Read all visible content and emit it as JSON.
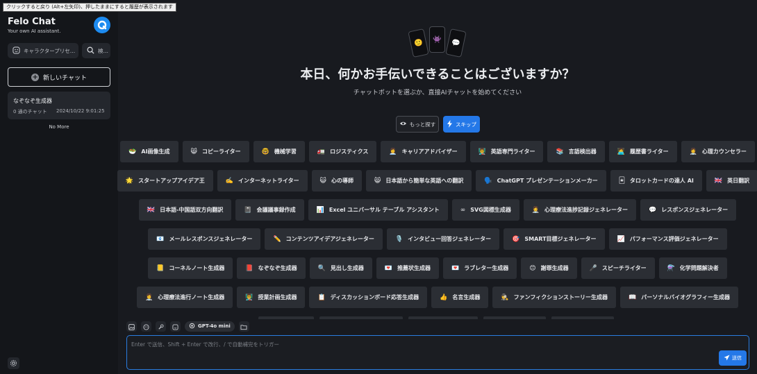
{
  "tooltip": "クリックすると戻り (Alt+左矢印)、押したままにすると履歴が表示されます",
  "sidebar": {
    "title": "Felo Chat",
    "subtitle": "Your own AI assistant.",
    "character_chip": "キャラクタープリセ…",
    "search_chip": "検…",
    "new_chat": "新しいチャット",
    "history": [
      {
        "title": "なぞなぞ生成器",
        "count": "0 通のチャット",
        "date": "2024/10/22 9:01:25"
      }
    ],
    "no_more": "No More"
  },
  "main": {
    "heading": "本日、何かお手伝いできることはございますか？",
    "subheading": "チャットボットを選ぶか、直接AIチャットを始めてください",
    "explore_label": "もっと探す",
    "skip_label": "スキップ",
    "rows": [
      [
        {
          "emoji": "🥗",
          "label": "AI画像生成"
        },
        {
          "emoji": "😸",
          "label": "コピーライター"
        },
        {
          "emoji": "🤓",
          "label": "機械学習"
        },
        {
          "emoji": "🚛",
          "label": "ロジスティクス"
        },
        {
          "emoji": "👩‍💼",
          "label": "キャリアアドバイザー"
        },
        {
          "emoji": "👨‍🏫",
          "label": "英語専門ライター"
        },
        {
          "emoji": "📚",
          "label": "言語検出器"
        },
        {
          "emoji": "🧑‍💻",
          "label": "履歴書ライター"
        },
        {
          "emoji": "👩‍⚕️",
          "label": "心理カウンセラー"
        }
      ],
      [
        {
          "emoji": "🌟",
          "label": "スタートアップアイデア王"
        },
        {
          "emoji": "✍️",
          "label": "インターネットライター"
        },
        {
          "emoji": "😺",
          "label": "心の導師"
        },
        {
          "emoji": "😸",
          "label": "日本語から簡単な英語への翻訳"
        },
        {
          "emoji": "🗣️",
          "label": "ChatGPT プレゼンテーションメーカー"
        },
        {
          "emoji": "🃏",
          "label": "タロットカードの達人 AI"
        },
        {
          "emoji": "🇬🇧",
          "label": "英日翻訳"
        }
      ],
      [
        {
          "emoji": "🇬🇧",
          "label": "日本語-中国語双方向翻訳"
        },
        {
          "emoji": "📓",
          "label": "会議議事録作成"
        },
        {
          "emoji": "📊",
          "label": "Excel ユニバーサル テーブル アシスタント"
        },
        {
          "emoji": "∞",
          "label": "SVG図標生成器"
        },
        {
          "emoji": "👩‍⚕️",
          "label": "心理療法進捗記録ジェネレーター"
        },
        {
          "emoji": "💬",
          "label": "レスポンスジェネレーター"
        }
      ],
      [
        {
          "emoji": "📧",
          "label": "メールレスポンスジェネレーター"
        },
        {
          "emoji": "✏️",
          "label": "コンテンツアイデアジェネレーター"
        },
        {
          "emoji": "🎙️",
          "label": "インタビュー回答ジェネレーター"
        },
        {
          "emoji": "🎯",
          "label": "SMART目標ジェネレーター"
        },
        {
          "emoji": "📈",
          "label": "パフォーマンス評価ジェネレーター"
        }
      ],
      [
        {
          "emoji": "📒",
          "label": "コーネルノート生成器"
        },
        {
          "emoji": "📕",
          "label": "なぞなぞ生成器"
        },
        {
          "emoji": "🔍",
          "label": "見出し生成器"
        },
        {
          "emoji": "💌",
          "label": "推薦状生成器"
        },
        {
          "emoji": "💌",
          "label": "ラブレター生成器"
        },
        {
          "emoji": "😊",
          "label": "謝罪生成器"
        },
        {
          "emoji": "🎤",
          "label": "スピーチライター"
        },
        {
          "emoji": "⚗️",
          "label": "化学問題解決者"
        }
      ],
      [
        {
          "emoji": "👩‍⚕️",
          "label": "心理療法進行ノート生成器"
        },
        {
          "emoji": "👨‍🏫",
          "label": "授業計画生成器"
        },
        {
          "emoji": "📋",
          "label": "ディスカッションボード応答生成器"
        },
        {
          "emoji": "👍",
          "label": "名言生成器"
        },
        {
          "emoji": "🕵️",
          "label": "ファンフィクションストーリー生成器"
        },
        {
          "emoji": "📖",
          "label": "パーソナルバイオグラフィー生成器"
        }
      ]
    ]
  },
  "composer": {
    "model": "GPT-4o mini",
    "placeholder": "Enter で送信、Shift + Enter で改行、/ で自動補完をトリガー",
    "send_label": "送信"
  },
  "colors": {
    "accent": "#2478e8",
    "background": "#181a1f",
    "card": "#2b2e34"
  }
}
